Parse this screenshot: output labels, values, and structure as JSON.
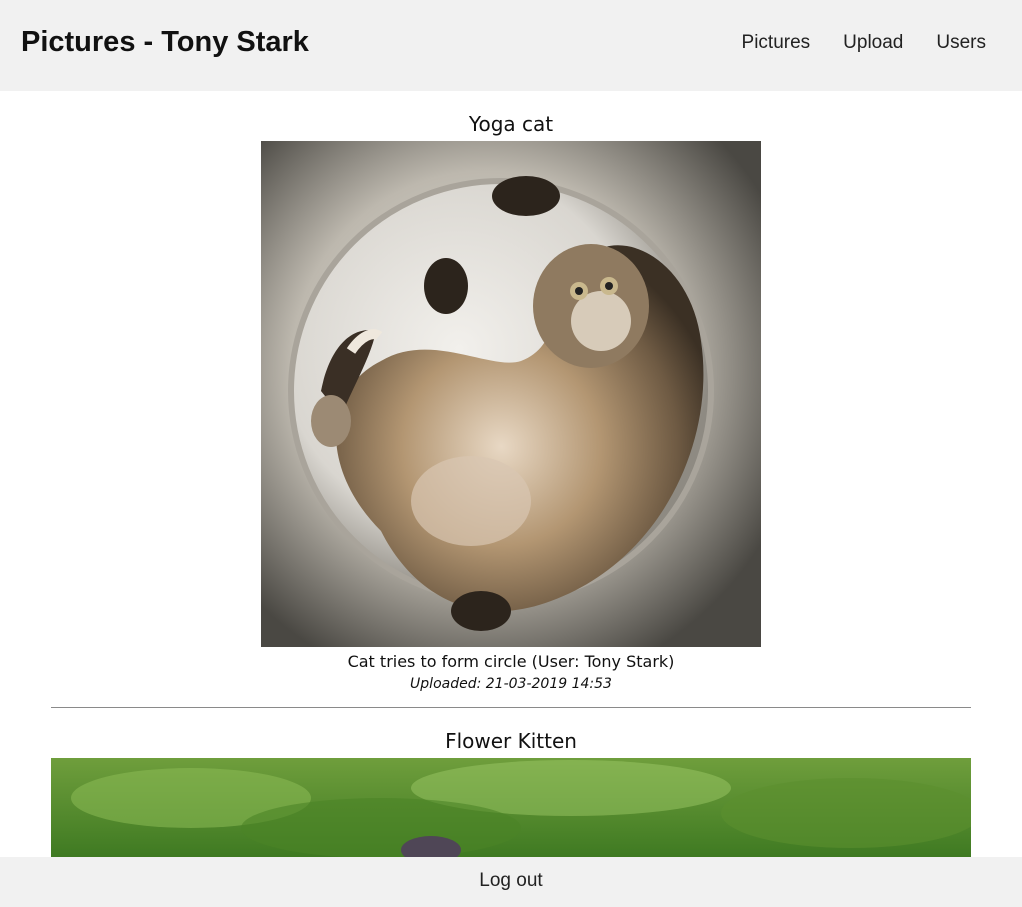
{
  "header": {
    "title": "Pictures - Tony Stark",
    "nav": [
      {
        "label": "Pictures"
      },
      {
        "label": "Upload"
      },
      {
        "label": "Users"
      }
    ]
  },
  "posts": [
    {
      "title": "Yoga cat",
      "image_subject": "cat curled in a bucket",
      "caption": "Cat tries to form circle (User: Tony Stark)",
      "uploaded": "Uploaded: 21-03-2019 14:53"
    },
    {
      "title": "Flower Kitten",
      "image_subject": "kitten in green grass"
    }
  ],
  "footer": {
    "logout_label": "Log out"
  },
  "colors": {
    "bar_background": "#f1f1f1",
    "divider": "#8a8a8a"
  }
}
